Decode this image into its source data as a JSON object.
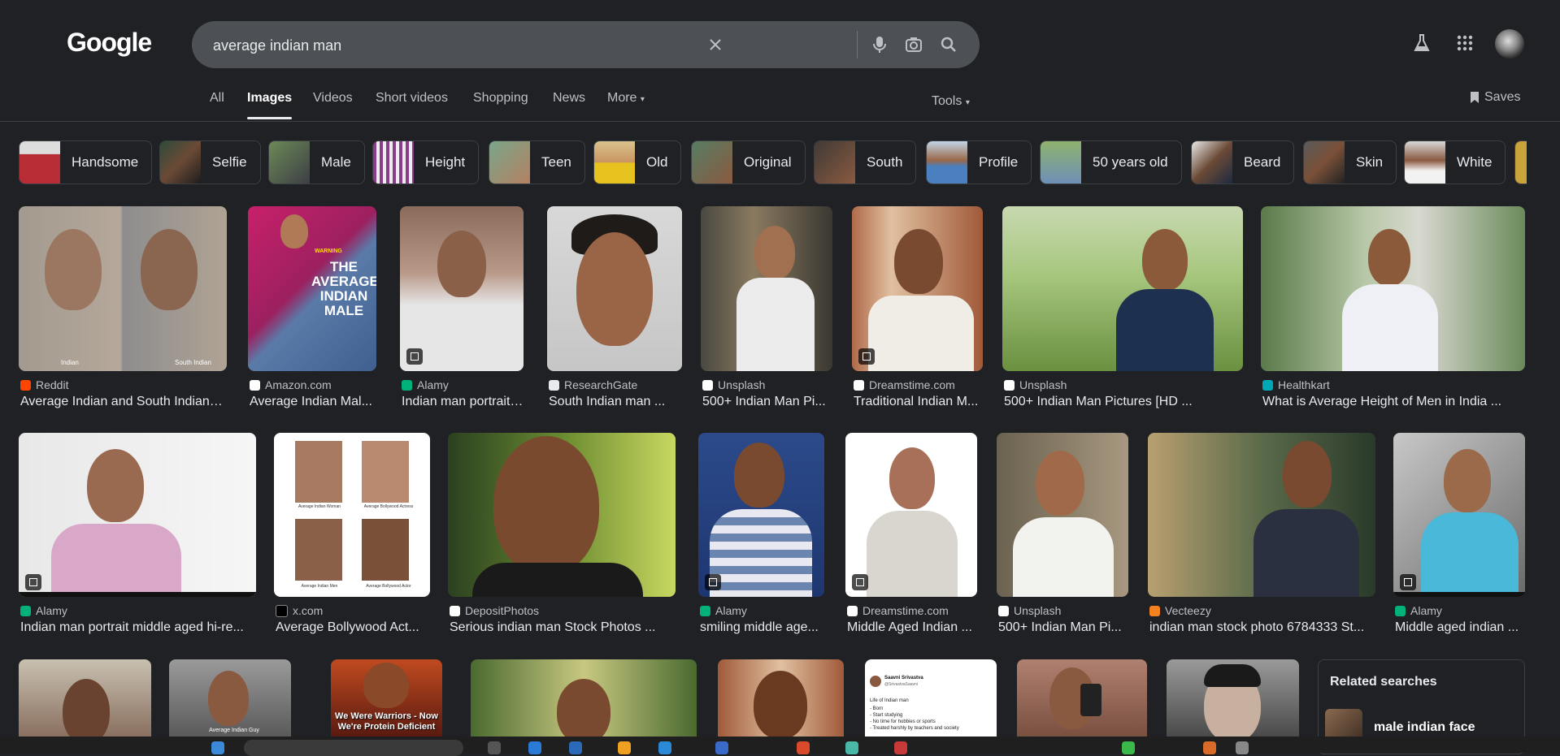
{
  "logo": "Google",
  "search": {
    "query": "average indian man"
  },
  "tabs": [
    {
      "label": "All"
    },
    {
      "label": "Images",
      "active": true
    },
    {
      "label": "Videos"
    },
    {
      "label": "Short videos"
    },
    {
      "label": "Shopping"
    },
    {
      "label": "News"
    },
    {
      "label": "More"
    }
  ],
  "tools": "Tools",
  "saves": "Saves",
  "chips": [
    "Handsome",
    "Selfie",
    "Male",
    "Height",
    "Teen",
    "Old",
    "Original",
    "South",
    "Profile",
    "50 years old",
    "Beard",
    "Skin",
    "White"
  ],
  "row1": [
    {
      "source": "Reddit",
      "title": "Average Indian and South Indian ...",
      "fav": "#ff4500"
    },
    {
      "source": "Amazon.com",
      "title": "Average Indian Mal...",
      "fav": "#ffffff"
    },
    {
      "source": "Alamy",
      "title": "Indian man portrait ...",
      "fav": "#00b27a"
    },
    {
      "source": "ResearchGate",
      "title": "South Indian man ...",
      "fav": "#e8eaed"
    },
    {
      "source": "Unsplash",
      "title": "500+ Indian Man Pi...",
      "fav": "#ffffff"
    },
    {
      "source": "Dreamstime.com",
      "title": "Traditional Indian M...",
      "fav": "#ffffff"
    },
    {
      "source": "Unsplash",
      "title": "500+ Indian Man Pictures [HD ...",
      "fav": "#ffffff"
    },
    {
      "source": "Healthkart",
      "title": "What is Average Height of Men in India ...",
      "fav": "#00a7b5"
    }
  ],
  "row2": [
    {
      "source": "Alamy",
      "title": "Indian man portrait middle aged hi-re...",
      "fav": "#00b27a"
    },
    {
      "source": "x.com",
      "title": "Average Bollywood Act...",
      "fav": "#000000"
    },
    {
      "source": "DepositPhotos",
      "title": "Serious indian man Stock Photos ...",
      "fav": "#ffffff"
    },
    {
      "source": "Alamy",
      "title": "smiling middle age...",
      "fav": "#00b27a"
    },
    {
      "source": "Dreamstime.com",
      "title": "Middle Aged Indian ...",
      "fav": "#ffffff"
    },
    {
      "source": "Unsplash",
      "title": "500+ Indian Man Pi...",
      "fav": "#ffffff"
    },
    {
      "source": "Vecteezy",
      "title": "indian man stock photo 6784333 St...",
      "fav": "#f5821f"
    },
    {
      "source": "Alamy",
      "title": "Middle aged indian ...",
      "fav": "#00b27a"
    }
  ],
  "image_text": {
    "amazon_book": "THE AVERAGE INDIAN MALE",
    "amazon_warning": "WARNING",
    "reddit_left": "Indian",
    "reddit_right": "South Indian",
    "x_labels": [
      "Average Indian Woman",
      "Average Bollywood Actress",
      "Average Indian Men",
      "Average Bollywood Actor"
    ],
    "meme": "We Were Warriors - Now We're Protein Deficient",
    "gym_caption": "Average Indian Guy",
    "tweet_name": "Saavni Srivastva",
    "tweet_handle": "@SrivastvaSaavni",
    "tweet_lines": [
      "Life of Indian man",
      "- Born",
      "- Start studying",
      "- No time for hobbies or sports",
      "- Treated harshly by teachers and society"
    ]
  },
  "related": {
    "title": "Related searches",
    "item": "male indian face"
  },
  "colors": {
    "bg": "#202124",
    "search_bg": "#4d5156",
    "text": "#e8eaed",
    "muted": "#bdc1c6"
  }
}
